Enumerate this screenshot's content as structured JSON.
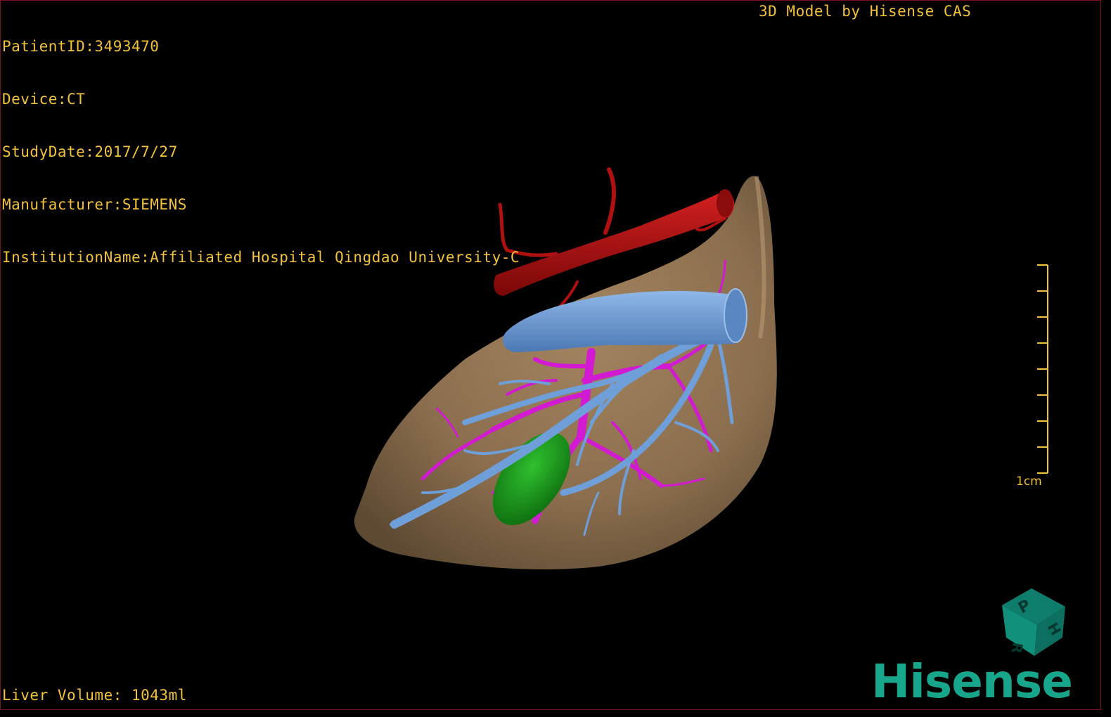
{
  "dicom": {
    "patient_id": "PatientID:3493470",
    "device": "Device:CT",
    "study_date": "StudyDate:2017/7/27",
    "manufacturer": "Manufacturer:SIEMENS",
    "institution": "InstitutionName:Affiliated Hospital Qingdao University-C"
  },
  "credit": "3D Model by Hisense CAS",
  "liver_volume": "Liver Volume: 1043ml",
  "scale_bar": {
    "label": "1cm",
    "ticks": 9
  },
  "brand": "Hisense",
  "orientation_cube": {
    "faces": [
      "P",
      "H",
      "R"
    ]
  },
  "colors": {
    "overlay_text": "#f2c23a",
    "liver": "#8b6e4e",
    "aorta": "#b01010",
    "vena_cava": "#6f9fd8",
    "portal_vessels": "#d21ad2",
    "gallbladder": "#1fa01f",
    "brand": "#17a58c",
    "frame": "#7a1020"
  }
}
